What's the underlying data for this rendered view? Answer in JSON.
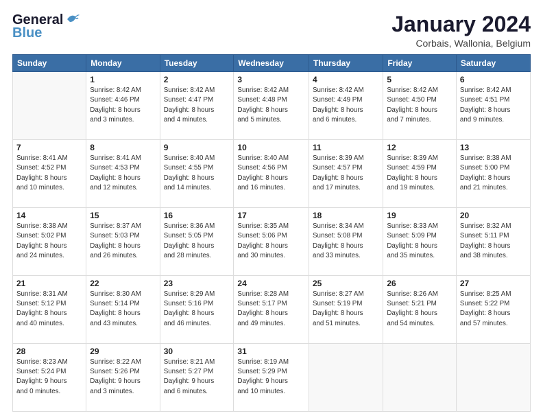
{
  "header": {
    "logo_general": "General",
    "logo_blue": "Blue",
    "month_title": "January 2024",
    "location": "Corbais, Wallonia, Belgium"
  },
  "calendar": {
    "days_of_week": [
      "Sunday",
      "Monday",
      "Tuesday",
      "Wednesday",
      "Thursday",
      "Friday",
      "Saturday"
    ],
    "weeks": [
      [
        {
          "day": "",
          "sunrise": "",
          "sunset": "",
          "daylight": ""
        },
        {
          "day": "1",
          "sunrise": "Sunrise: 8:42 AM",
          "sunset": "Sunset: 4:46 PM",
          "daylight": "Daylight: 8 hours and 3 minutes."
        },
        {
          "day": "2",
          "sunrise": "Sunrise: 8:42 AM",
          "sunset": "Sunset: 4:47 PM",
          "daylight": "Daylight: 8 hours and 4 minutes."
        },
        {
          "day": "3",
          "sunrise": "Sunrise: 8:42 AM",
          "sunset": "Sunset: 4:48 PM",
          "daylight": "Daylight: 8 hours and 5 minutes."
        },
        {
          "day": "4",
          "sunrise": "Sunrise: 8:42 AM",
          "sunset": "Sunset: 4:49 PM",
          "daylight": "Daylight: 8 hours and 6 minutes."
        },
        {
          "day": "5",
          "sunrise": "Sunrise: 8:42 AM",
          "sunset": "Sunset: 4:50 PM",
          "daylight": "Daylight: 8 hours and 7 minutes."
        },
        {
          "day": "6",
          "sunrise": "Sunrise: 8:42 AM",
          "sunset": "Sunset: 4:51 PM",
          "daylight": "Daylight: 8 hours and 9 minutes."
        }
      ],
      [
        {
          "day": "7",
          "sunrise": "Sunrise: 8:41 AM",
          "sunset": "Sunset: 4:52 PM",
          "daylight": "Daylight: 8 hours and 10 minutes."
        },
        {
          "day": "8",
          "sunrise": "Sunrise: 8:41 AM",
          "sunset": "Sunset: 4:53 PM",
          "daylight": "Daylight: 8 hours and 12 minutes."
        },
        {
          "day": "9",
          "sunrise": "Sunrise: 8:40 AM",
          "sunset": "Sunset: 4:55 PM",
          "daylight": "Daylight: 8 hours and 14 minutes."
        },
        {
          "day": "10",
          "sunrise": "Sunrise: 8:40 AM",
          "sunset": "Sunset: 4:56 PM",
          "daylight": "Daylight: 8 hours and 16 minutes."
        },
        {
          "day": "11",
          "sunrise": "Sunrise: 8:39 AM",
          "sunset": "Sunset: 4:57 PM",
          "daylight": "Daylight: 8 hours and 17 minutes."
        },
        {
          "day": "12",
          "sunrise": "Sunrise: 8:39 AM",
          "sunset": "Sunset: 4:59 PM",
          "daylight": "Daylight: 8 hours and 19 minutes."
        },
        {
          "day": "13",
          "sunrise": "Sunrise: 8:38 AM",
          "sunset": "Sunset: 5:00 PM",
          "daylight": "Daylight: 8 hours and 21 minutes."
        }
      ],
      [
        {
          "day": "14",
          "sunrise": "Sunrise: 8:38 AM",
          "sunset": "Sunset: 5:02 PM",
          "daylight": "Daylight: 8 hours and 24 minutes."
        },
        {
          "day": "15",
          "sunrise": "Sunrise: 8:37 AM",
          "sunset": "Sunset: 5:03 PM",
          "daylight": "Daylight: 8 hours and 26 minutes."
        },
        {
          "day": "16",
          "sunrise": "Sunrise: 8:36 AM",
          "sunset": "Sunset: 5:05 PM",
          "daylight": "Daylight: 8 hours and 28 minutes."
        },
        {
          "day": "17",
          "sunrise": "Sunrise: 8:35 AM",
          "sunset": "Sunset: 5:06 PM",
          "daylight": "Daylight: 8 hours and 30 minutes."
        },
        {
          "day": "18",
          "sunrise": "Sunrise: 8:34 AM",
          "sunset": "Sunset: 5:08 PM",
          "daylight": "Daylight: 8 hours and 33 minutes."
        },
        {
          "day": "19",
          "sunrise": "Sunrise: 8:33 AM",
          "sunset": "Sunset: 5:09 PM",
          "daylight": "Daylight: 8 hours and 35 minutes."
        },
        {
          "day": "20",
          "sunrise": "Sunrise: 8:32 AM",
          "sunset": "Sunset: 5:11 PM",
          "daylight": "Daylight: 8 hours and 38 minutes."
        }
      ],
      [
        {
          "day": "21",
          "sunrise": "Sunrise: 8:31 AM",
          "sunset": "Sunset: 5:12 PM",
          "daylight": "Daylight: 8 hours and 40 minutes."
        },
        {
          "day": "22",
          "sunrise": "Sunrise: 8:30 AM",
          "sunset": "Sunset: 5:14 PM",
          "daylight": "Daylight: 8 hours and 43 minutes."
        },
        {
          "day": "23",
          "sunrise": "Sunrise: 8:29 AM",
          "sunset": "Sunset: 5:16 PM",
          "daylight": "Daylight: 8 hours and 46 minutes."
        },
        {
          "day": "24",
          "sunrise": "Sunrise: 8:28 AM",
          "sunset": "Sunset: 5:17 PM",
          "daylight": "Daylight: 8 hours and 49 minutes."
        },
        {
          "day": "25",
          "sunrise": "Sunrise: 8:27 AM",
          "sunset": "Sunset: 5:19 PM",
          "daylight": "Daylight: 8 hours and 51 minutes."
        },
        {
          "day": "26",
          "sunrise": "Sunrise: 8:26 AM",
          "sunset": "Sunset: 5:21 PM",
          "daylight": "Daylight: 8 hours and 54 minutes."
        },
        {
          "day": "27",
          "sunrise": "Sunrise: 8:25 AM",
          "sunset": "Sunset: 5:22 PM",
          "daylight": "Daylight: 8 hours and 57 minutes."
        }
      ],
      [
        {
          "day": "28",
          "sunrise": "Sunrise: 8:23 AM",
          "sunset": "Sunset: 5:24 PM",
          "daylight": "Daylight: 9 hours and 0 minutes."
        },
        {
          "day": "29",
          "sunrise": "Sunrise: 8:22 AM",
          "sunset": "Sunset: 5:26 PM",
          "daylight": "Daylight: 9 hours and 3 minutes."
        },
        {
          "day": "30",
          "sunrise": "Sunrise: 8:21 AM",
          "sunset": "Sunset: 5:27 PM",
          "daylight": "Daylight: 9 hours and 6 minutes."
        },
        {
          "day": "31",
          "sunrise": "Sunrise: 8:19 AM",
          "sunset": "Sunset: 5:29 PM",
          "daylight": "Daylight: 9 hours and 10 minutes."
        },
        {
          "day": "",
          "sunrise": "",
          "sunset": "",
          "daylight": ""
        },
        {
          "day": "",
          "sunrise": "",
          "sunset": "",
          "daylight": ""
        },
        {
          "day": "",
          "sunrise": "",
          "sunset": "",
          "daylight": ""
        }
      ]
    ]
  }
}
